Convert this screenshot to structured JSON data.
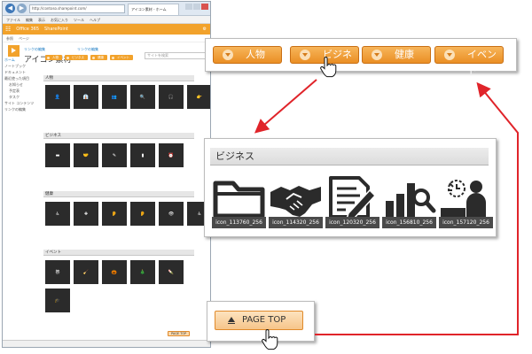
{
  "browser": {
    "url": "http://contoso.sharepoint.com/",
    "tab_label": "アイコン素材 - ホーム",
    "menu": [
      "ファイル",
      "編集",
      "表示",
      "お気に入り",
      "ツール",
      "ヘルプ"
    ]
  },
  "sharepoint": {
    "suite_bar": [
      "Office 365",
      "SharePoint"
    ],
    "commands": [
      "参照",
      "ページ"
    ],
    "edit_link": "リンクの編集",
    "site_title": "アイコン素材",
    "search_placeholder": "サイトを検索",
    "nav": [
      {
        "label": "ホーム",
        "selected": true,
        "sub": false
      },
      {
        "label": "ノートブック",
        "selected": false,
        "sub": false
      },
      {
        "label": "ドキュメント",
        "selected": false,
        "sub": false
      },
      {
        "label": "最近使った項目",
        "selected": false,
        "sub": false
      },
      {
        "label": "お知らせ",
        "selected": false,
        "sub": true
      },
      {
        "label": "予定表",
        "selected": false,
        "sub": true
      },
      {
        "label": "タスク",
        "selected": false,
        "sub": true
      },
      {
        "label": "サイト コンテンツ",
        "selected": false,
        "sub": false
      },
      {
        "label": "リンクの編集",
        "selected": false,
        "sub": false
      }
    ],
    "categories": [
      "人物",
      "ビジネス",
      "健康",
      "イベント"
    ],
    "sections": [
      {
        "title": "人物"
      },
      {
        "title": "ビジネス"
      },
      {
        "title": "健康"
      },
      {
        "title": "イベント"
      }
    ],
    "page_top_label": "PAGE TOP"
  },
  "callouts": {
    "nav_buttons": [
      "人物",
      "ビジネス",
      "健康",
      "イベント"
    ],
    "section_title": "ビジネス",
    "icons": [
      {
        "caption": "icon_113760_256",
        "icon": "folder-icon"
      },
      {
        "caption": "icon_114320_256",
        "icon": "handshake-icon"
      },
      {
        "caption": "icon_120320_256",
        "icon": "document-pen-icon"
      },
      {
        "caption": "icon_156810_256",
        "icon": "chart-magnifier-icon"
      },
      {
        "caption": "icon_157120_256",
        "icon": "person-clock-icon"
      }
    ],
    "page_top_label": "PAGE TOP"
  },
  "colors": {
    "accent_orange": "#ea8f24",
    "arrow_red": "#e0242a",
    "icon_dark": "#2b2b2b"
  }
}
